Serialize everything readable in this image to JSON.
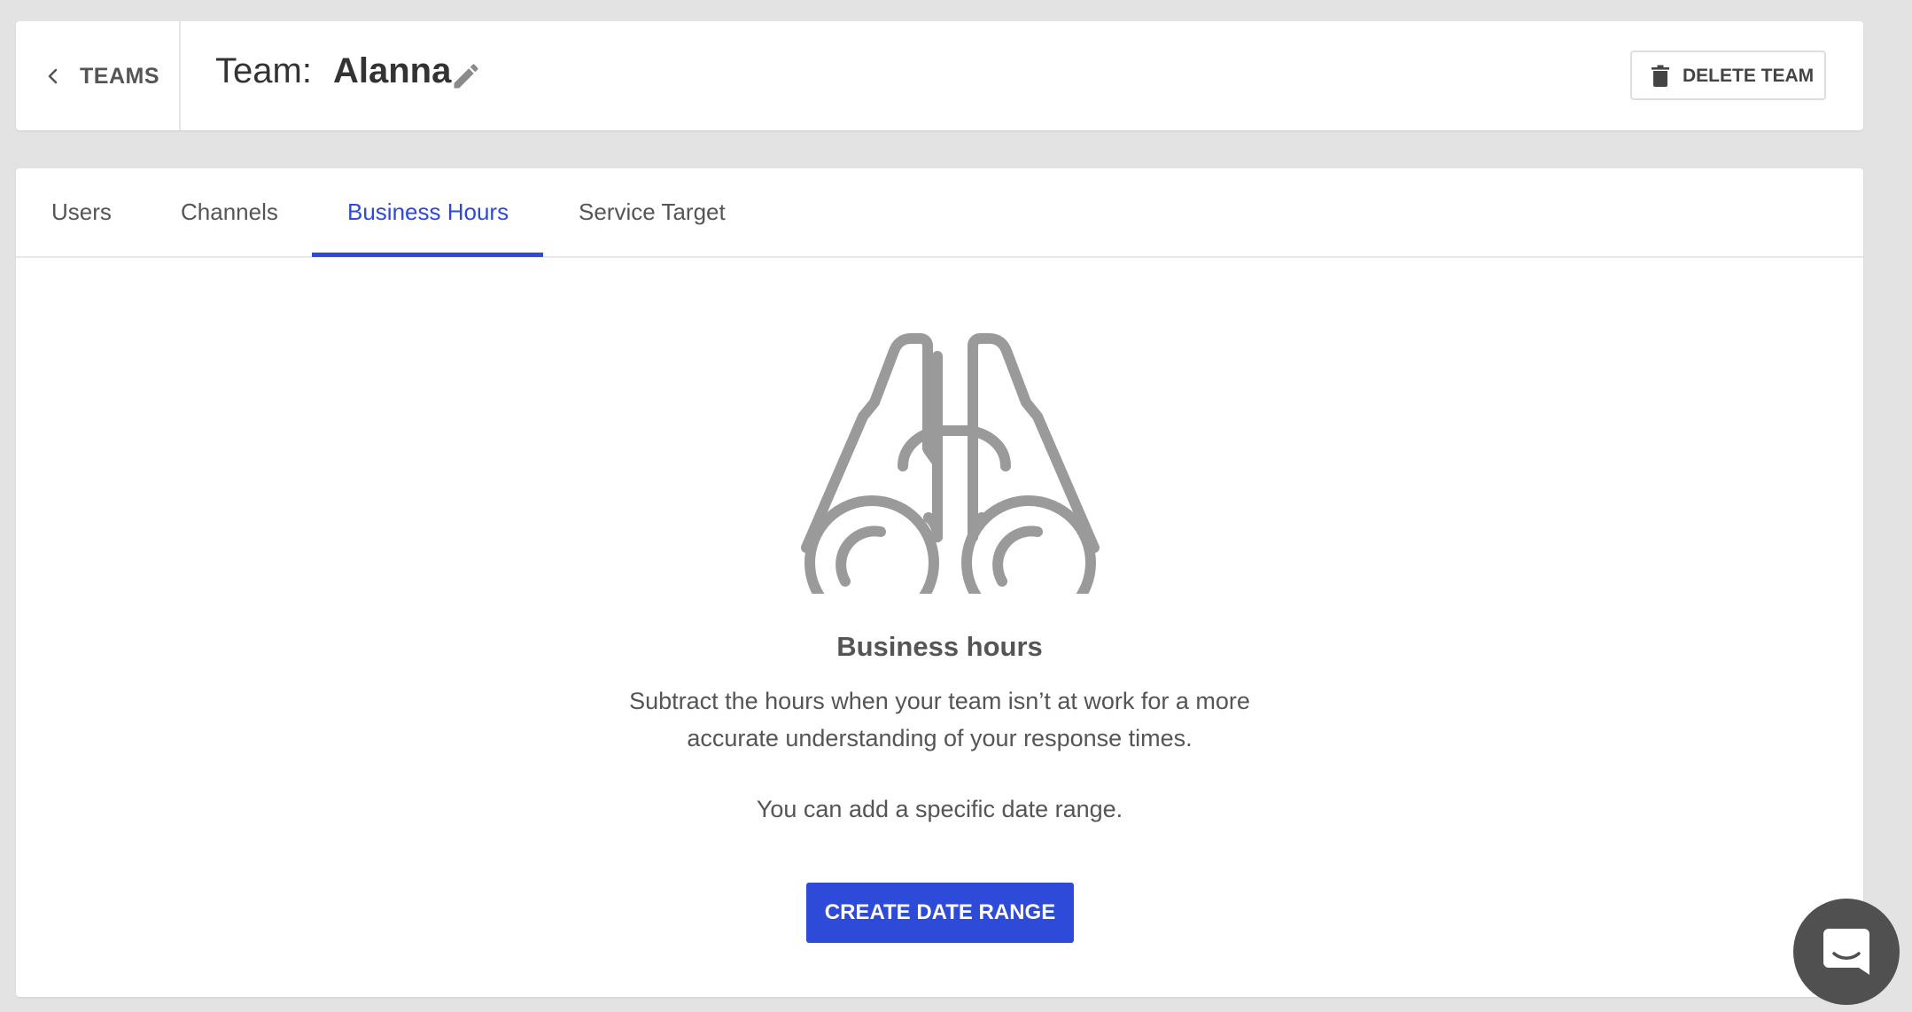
{
  "header": {
    "back_label": "TEAMS",
    "team_prefix": "Team:",
    "team_name": "Alanna",
    "delete_label": "DELETE TEAM"
  },
  "tabs": [
    {
      "label": "Users",
      "active": false
    },
    {
      "label": "Channels",
      "active": false
    },
    {
      "label": "Business Hours",
      "active": true
    },
    {
      "label": "Service Target",
      "active": false
    }
  ],
  "empty_state": {
    "icon": "binoculars-icon",
    "title": "Business hours",
    "description_line1": "Subtract the hours when your team isn’t at work for a more",
    "description_line2": "accurate understanding of your response times.",
    "note": "You can add a specific date range.",
    "button_label": "CREATE DATE RANGE"
  },
  "colors": {
    "accent": "#2d4ad8",
    "background": "#e3e3e3",
    "text": "#555555",
    "icon_gray": "#9a9a9a",
    "chat_launcher": "#505050"
  },
  "icons": {
    "back": "chevron-left-icon",
    "edit": "pencil-icon",
    "delete": "trash-icon",
    "chat": "chat-icon"
  }
}
